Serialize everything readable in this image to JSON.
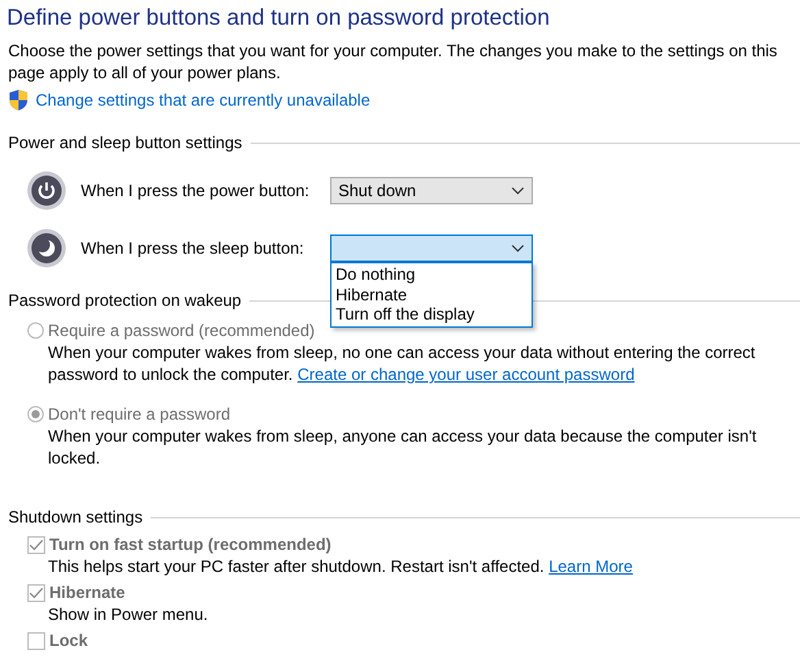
{
  "title": "Define power buttons and turn on password protection",
  "intro": "Choose the power settings that you want for your computer. The changes you make to the settings on this page apply to all of your power plans.",
  "admin_link": "Change settings that are currently unavailable",
  "button_section": {
    "heading": "Power and sleep button settings",
    "rows": [
      {
        "kind": "power",
        "label": "When I press the power button:",
        "value": "Shut down",
        "open": false
      },
      {
        "kind": "sleep",
        "label": "When I press the sleep button:",
        "open": true,
        "options": [
          {
            "label": "Do nothing"
          },
          {
            "label": "Hibernate"
          },
          {
            "label": "Turn off the display"
          }
        ]
      }
    ]
  },
  "password_section": {
    "heading": "Password protection on wakeup",
    "options": [
      {
        "label": "Require a password (recommended)",
        "selected": false,
        "disabled": true,
        "description": "When your computer wakes from sleep, no one can access your data without entering the correct password to unlock the computer.",
        "link": "Create or change your user account password"
      },
      {
        "label": "Don't require a password",
        "selected": true,
        "disabled": true,
        "description": "When your computer wakes from sleep, anyone can access your data because the computer isn't locked."
      }
    ]
  },
  "shutdown_section": {
    "heading": "Shutdown settings",
    "options": [
      {
        "label": "Turn on fast startup (recommended)",
        "checked": true,
        "disabled": true,
        "description": "This helps start your PC faster after shutdown. Restart isn't affected.",
        "link": "Learn More"
      },
      {
        "label": "Hibernate",
        "checked": true,
        "disabled": true,
        "description": "Show in Power menu."
      },
      {
        "label": "Lock",
        "checked": false,
        "disabled": true
      }
    ]
  }
}
